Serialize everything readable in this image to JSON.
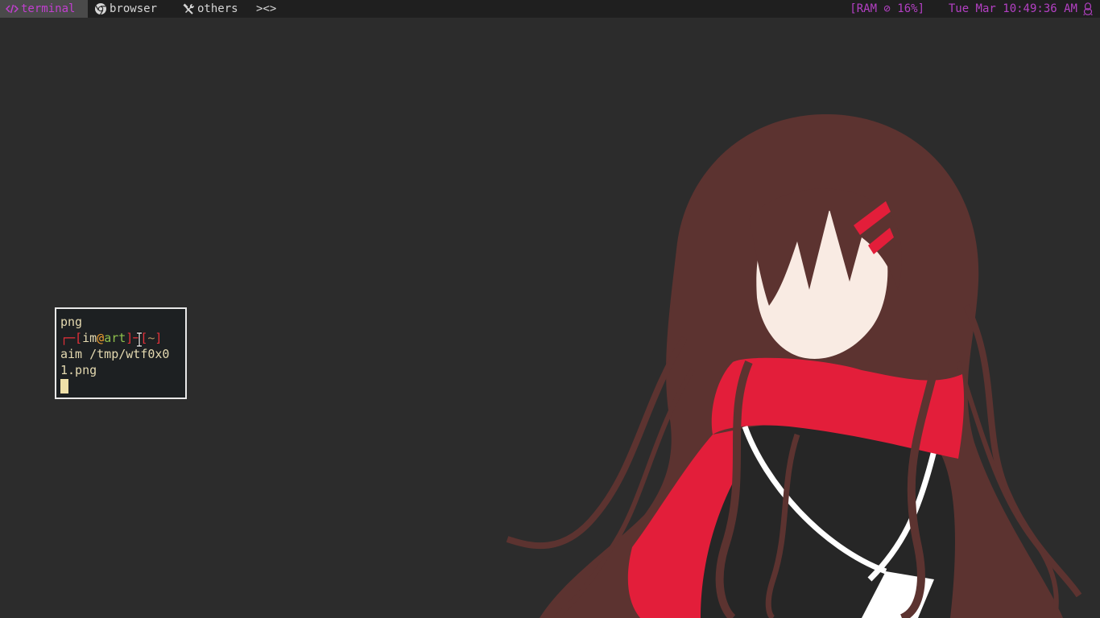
{
  "topbar": {
    "workspaces": [
      {
        "label": "terminal",
        "icon": "code-icon",
        "active": true
      },
      {
        "label": "browser",
        "icon": "chrome-icon",
        "active": false
      },
      {
        "label": "others",
        "icon": "tools-icon",
        "active": false
      }
    ],
    "layout_indicator": "><>",
    "ram_status": "[RAM ⊘ 16%]",
    "clock": "Tue Mar 10:49:36 AM",
    "tray_icon": "linux-tux-icon",
    "colors": {
      "bar_bg": "#1f1f1f",
      "active_ws_bg": "#4a4a4a",
      "accent": "#c23fd0"
    }
  },
  "terminal": {
    "lines": {
      "line1": "png",
      "prompt_open": "┌─[",
      "prompt_user": "im",
      "prompt_at": "@",
      "prompt_host": "art",
      "prompt_sep": "]─[",
      "prompt_dir": "~",
      "prompt_close": "]",
      "line3": "aim /tmp/wtf0x0",
      "line4": "1.png"
    },
    "colors": {
      "bg": "#1d2022",
      "fg": "#e4d9b0",
      "prompt": "#e5303a"
    }
  },
  "wallpaper": {
    "subject": "anime-girl-red-scarf",
    "colors": {
      "hair": "#5c3330",
      "scarf": "#e31e3a",
      "skin": "#f9ebe3",
      "uniform": "#262626"
    }
  }
}
